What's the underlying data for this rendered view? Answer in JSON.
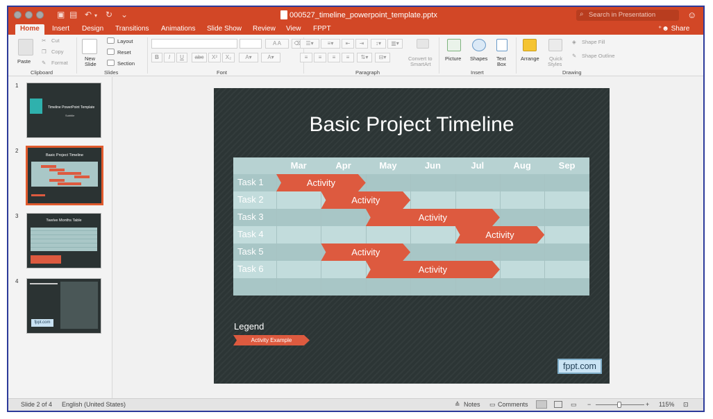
{
  "window": {
    "title": "000527_timeline_powerpoint_template.pptx",
    "search_placeholder": "Search in Presentation"
  },
  "tabs": [
    {
      "label": "Home",
      "active": true
    },
    {
      "label": "Insert"
    },
    {
      "label": "Design"
    },
    {
      "label": "Transitions"
    },
    {
      "label": "Animations"
    },
    {
      "label": "Slide Show"
    },
    {
      "label": "Review"
    },
    {
      "label": "View"
    },
    {
      "label": "FPPT"
    }
  ],
  "share_label": "Share",
  "ribbon": {
    "clipboard": {
      "paste": "Paste",
      "cut": "Cut",
      "copy": "Copy",
      "format": "Format",
      "group": "Clipboard"
    },
    "slides": {
      "new_slide_1": "New",
      "new_slide_2": "Slide",
      "layout": "Layout",
      "reset": "Reset",
      "section": "Section",
      "group": "Slides"
    },
    "font": {
      "bold": "B",
      "italic": "I",
      "underline": "U",
      "strike": "abc",
      "superscript": "X²",
      "subscript": "X₂",
      "group": "Font"
    },
    "paragraph": {
      "convert_1": "Convert to",
      "convert_2": "SmartArt",
      "group": "Paragraph"
    },
    "insert": {
      "picture": "Picture",
      "shapes": "Shapes",
      "textbox_1": "Text",
      "textbox_2": "Box",
      "group": "Insert"
    },
    "drawing": {
      "arrange": "Arrange",
      "quick_styles_1": "Quick",
      "quick_styles_2": "Styles",
      "shape_fill": "Shape Fill",
      "shape_outline": "Shape Outline",
      "group": "Drawing"
    }
  },
  "thumbnails": [
    {
      "num": "1",
      "title": "Timeline PowerPoint Template",
      "subtitle": "Subtitle"
    },
    {
      "num": "2",
      "title": "Basic Project Timeline"
    },
    {
      "num": "3",
      "title": "Twelve Months Table"
    },
    {
      "num": "4",
      "title": "fppt.com"
    }
  ],
  "slide": {
    "title": "Basic Project Timeline",
    "months": [
      "Mar",
      "Apr",
      "May",
      "Jun",
      "Jul",
      "Aug",
      "Sep"
    ],
    "tasks": [
      "Task 1",
      "Task 2",
      "Task 3",
      "Task 4",
      "Task 5",
      "Task 6"
    ],
    "activity_label": "Activity",
    "bars": [
      {
        "task": "Task 1",
        "start_month": "Mar",
        "end_month": "Apr"
      },
      {
        "task": "Task 2",
        "start_month": "Apr",
        "end_month": "May"
      },
      {
        "task": "Task 3",
        "start_month": "May",
        "end_month": "Jul"
      },
      {
        "task": "Task 4",
        "start_month": "Jul",
        "end_month": "Aug"
      },
      {
        "task": "Task 5",
        "start_month": "Apr",
        "end_month": "May"
      },
      {
        "task": "Task 6",
        "start_month": "May",
        "end_month": "Jul"
      }
    ],
    "legend_title": "Legend",
    "legend_example": "Activity Example",
    "badge": "fppt.com"
  },
  "status": {
    "slide_info": "Slide 2 of 4",
    "language": "English (United States)",
    "notes": "Notes",
    "comments": "Comments",
    "zoom": "115%"
  },
  "colors": {
    "accent": "#d24726",
    "activity_bar": "#dd5a3f",
    "slide_bg": "#2c3535",
    "grid_bg": "#b7d2d2"
  }
}
